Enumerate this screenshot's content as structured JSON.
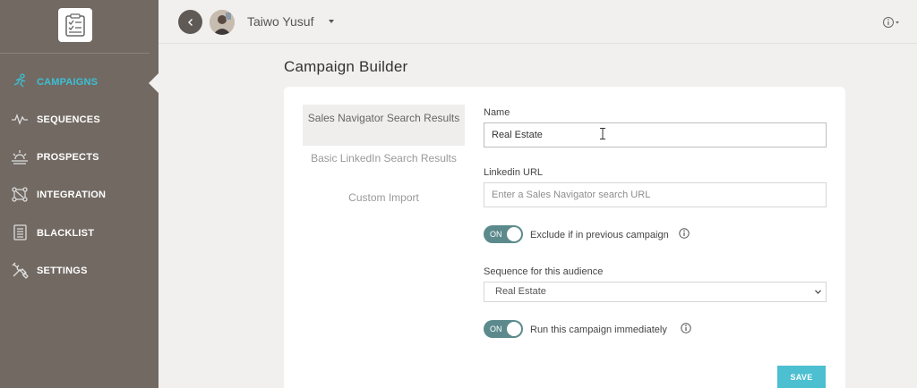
{
  "header": {
    "user_name": "Taiwo Yusuf"
  },
  "sidebar": {
    "items": [
      {
        "label": "CAMPAIGNS",
        "icon": "running-person-icon",
        "active": true
      },
      {
        "label": "SEQUENCES",
        "icon": "pulse-icon",
        "active": false
      },
      {
        "label": "PROSPECTS",
        "icon": "sunrise-icon",
        "active": false
      },
      {
        "label": "INTEGRATION",
        "icon": "integration-icon",
        "active": false
      },
      {
        "label": "BLACKLIST",
        "icon": "notebook-icon",
        "active": false
      },
      {
        "label": "SETTINGS",
        "icon": "tools-icon",
        "active": false
      }
    ]
  },
  "page": {
    "title": "Campaign Builder"
  },
  "source_tabs": [
    {
      "label": "Sales Navigator Search Results",
      "active": true
    },
    {
      "label": "Basic LinkedIn Search Results",
      "active": false
    },
    {
      "label": "Custom Import",
      "active": false
    }
  ],
  "form": {
    "name_label": "Name",
    "name_value": "Real Estate",
    "linkedin_label": "Linkedin URL",
    "linkedin_placeholder": "Enter a Sales Navigator search URL",
    "exclude_toggle_state": "ON",
    "exclude_label": "Exclude if in previous campaign",
    "sequence_label": "Sequence for this audience",
    "sequence_selected": "Real Estate",
    "run_toggle_state": "ON",
    "run_label": "Run this campaign immediately",
    "save_label": "SAVE"
  },
  "colors": {
    "sidebar_bg": "#716962",
    "accent": "#3cc0d6",
    "save_button": "#4cbfd1",
    "toggle_on": "#5c8a8c"
  }
}
